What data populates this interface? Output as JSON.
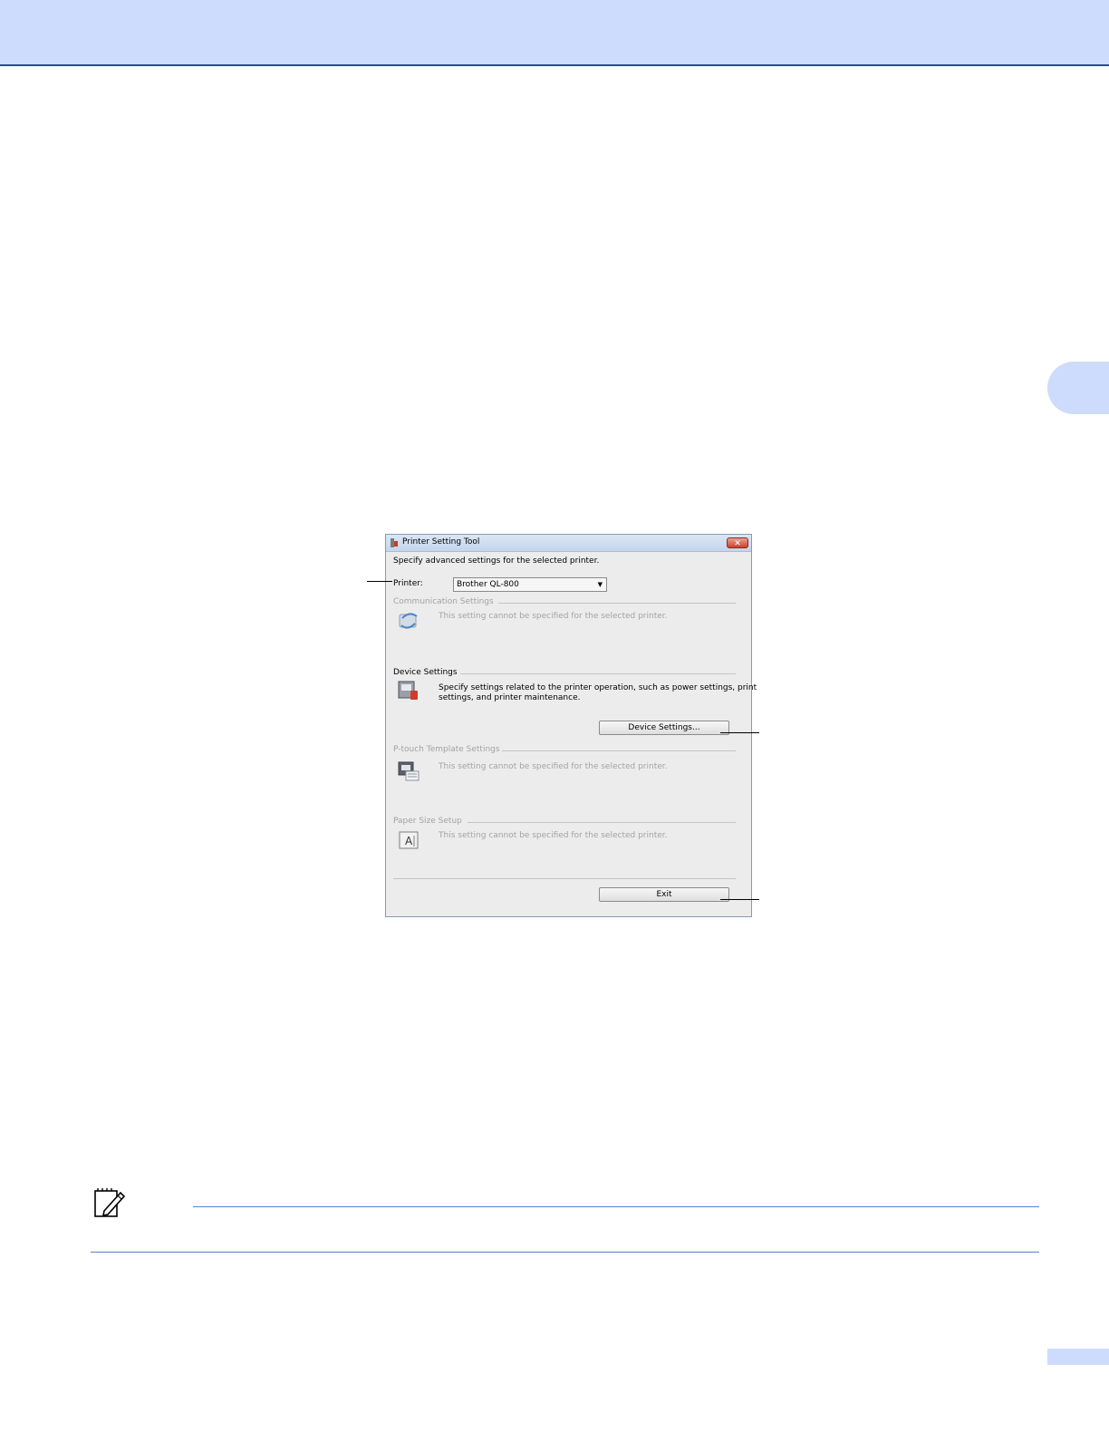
{
  "dialog": {
    "title": "Printer Setting Tool",
    "close_label": "✕",
    "instruction": "Specify advanced settings for the selected printer.",
    "printer_label": "Printer:",
    "printer_value": "Brother QL-800",
    "sections": {
      "communication": {
        "heading": "Communication Settings",
        "description": "This setting cannot be specified for the selected printer.",
        "icon": "communication-settings-icon"
      },
      "device": {
        "heading": "Device Settings",
        "description_line1": "Specify settings related to the printer operation, such as power settings, print",
        "description_line2": "settings, and printer maintenance.",
        "button_label": "Device Settings...",
        "icon": "device-settings-icon"
      },
      "ptouch": {
        "heading": "P-touch Template Settings",
        "description": "This setting cannot be specified for the selected printer.",
        "icon": "ptouch-template-icon"
      },
      "paper": {
        "heading": "Paper Size Setup",
        "description": "This setting cannot be specified for the selected printer.",
        "icon": "paper-size-icon"
      }
    },
    "exit_label": "Exit"
  },
  "colors": {
    "header_band": "#cddcfd",
    "header_rule": "#1f4fa0",
    "note_rule": "#5b7fcf"
  }
}
